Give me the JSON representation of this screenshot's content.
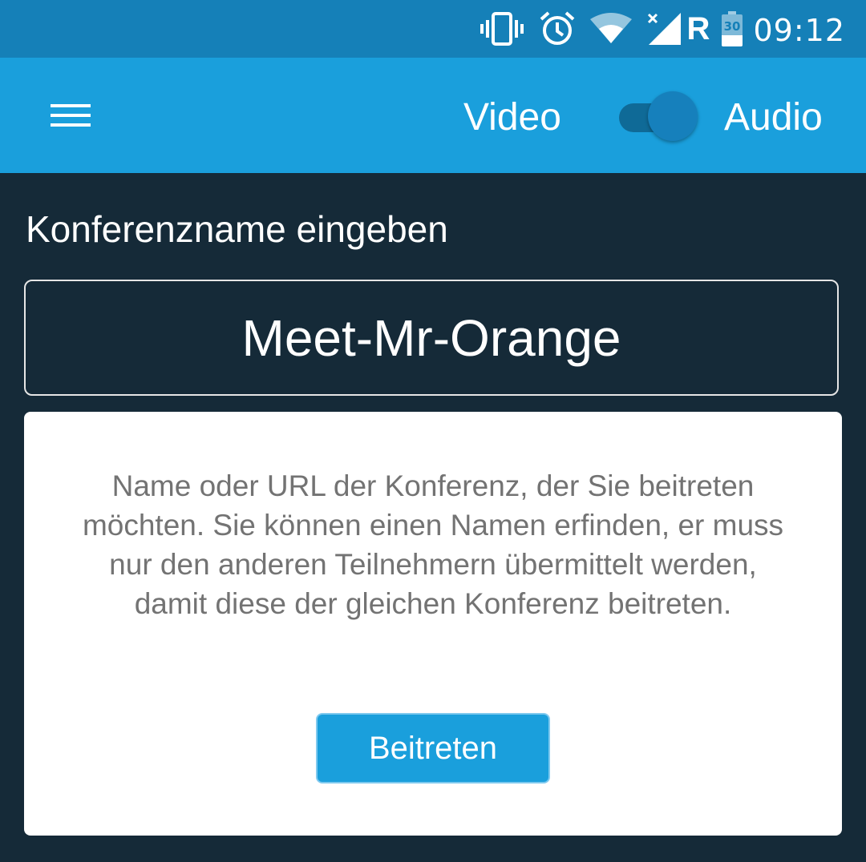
{
  "status_bar": {
    "time": "09:12",
    "battery_level": "30",
    "network_label": "R",
    "icons": [
      "vibrate-icon",
      "alarm-icon",
      "wifi-icon",
      "signal-icon",
      "battery-icon"
    ]
  },
  "app_bar": {
    "menu_icon": "hamburger-menu-icon",
    "video_label": "Video",
    "audio_label": "Audio",
    "toggle_state": "audio"
  },
  "main": {
    "section_title": "Konferenzname eingeben",
    "room_name_value": "Meet-Mr-Orange",
    "help_text": "Name oder URL der Konferenz, der Sie beitreten möchten. Sie können einen Namen erfinden, er muss nur den anderen Teilnehmern übermittelt werden, damit diese der gleichen Konferenz beitreten.",
    "join_button_label": "Beitreten"
  },
  "colors": {
    "status_bar": "#1580b8",
    "app_bar": "#1a9fdc",
    "background": "#152a38",
    "card": "#ffffff",
    "help_text": "#737373",
    "accent": "#1a9fdc"
  }
}
